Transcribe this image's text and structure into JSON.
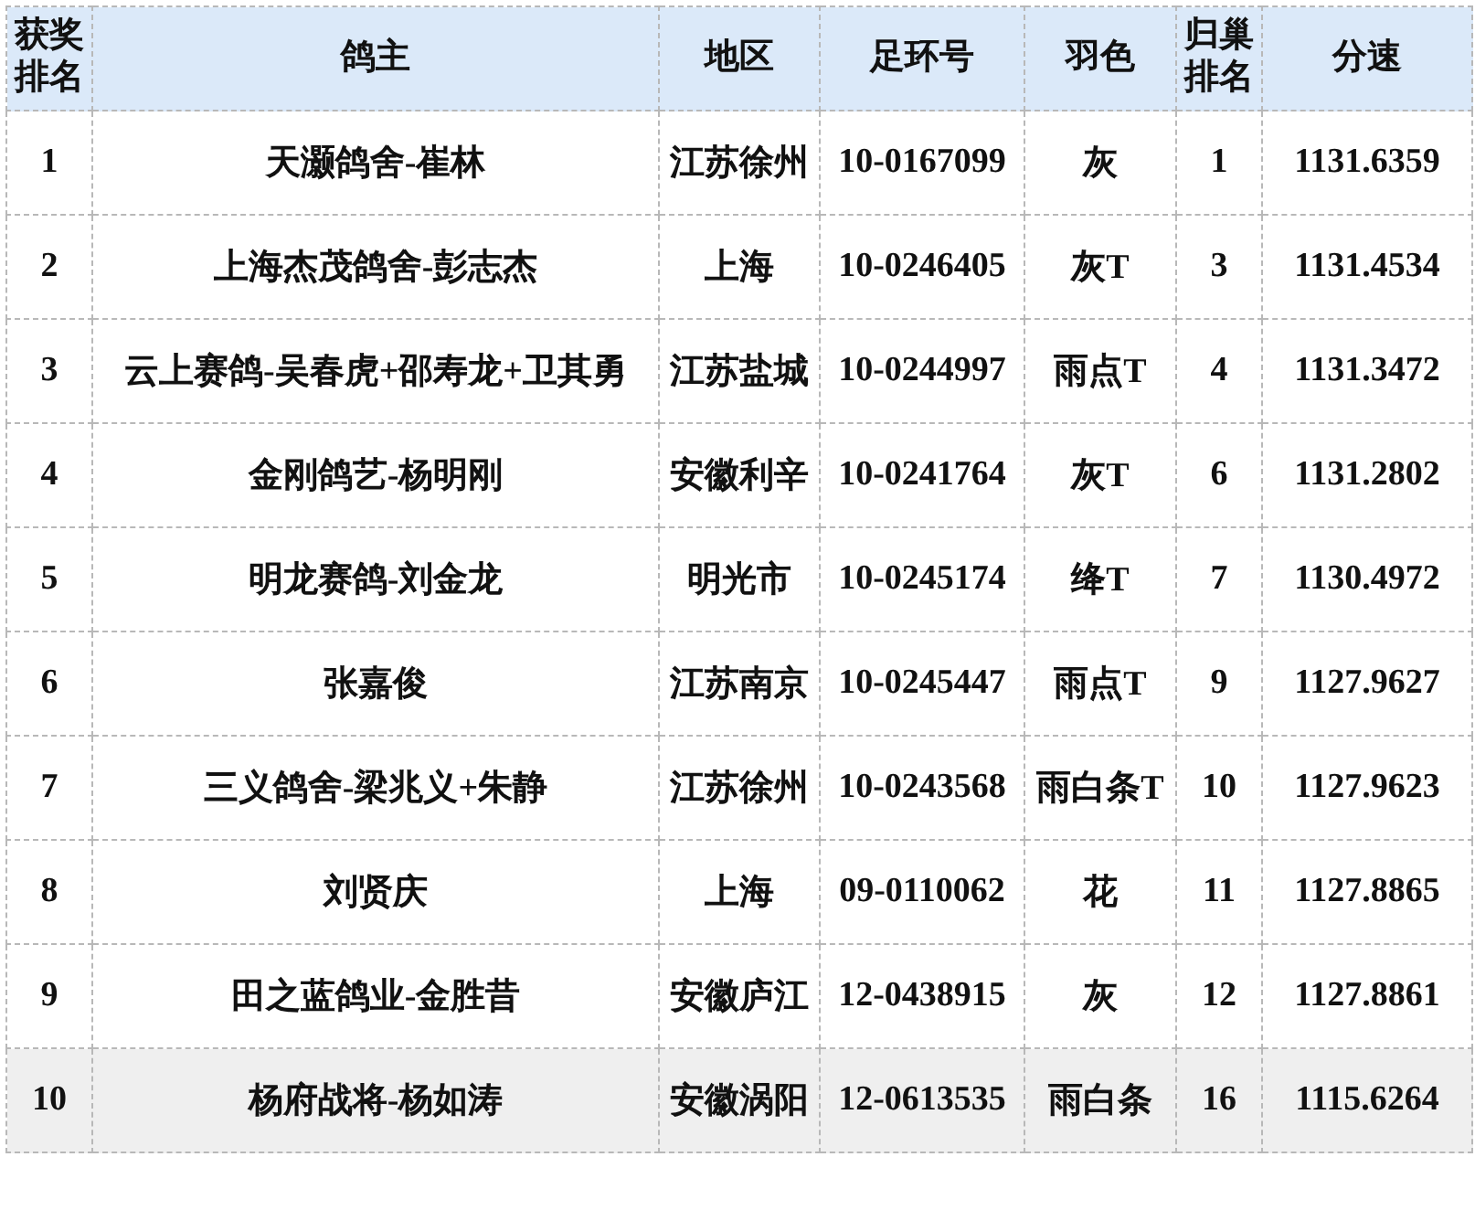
{
  "table": {
    "columns": [
      "获奖排名",
      "鸽主",
      "地区",
      "足环号",
      "羽色",
      "归巢排名",
      "分速"
    ],
    "rows": [
      {
        "cells": [
          "1",
          "天灏鸽舍-崔林",
          "江苏徐州",
          "10-0167099",
          "灰",
          "1",
          "1131.6359"
        ],
        "highlighted": false
      },
      {
        "cells": [
          "2",
          "上海杰茂鸽舍-彭志杰",
          "上海",
          "10-0246405",
          "灰T",
          "3",
          "1131.4534"
        ],
        "highlighted": false
      },
      {
        "cells": [
          "3",
          "云上赛鸽-吴春虎+邵寿龙+卫其勇",
          "江苏盐城",
          "10-0244997",
          "雨点T",
          "4",
          "1131.3472"
        ],
        "highlighted": false
      },
      {
        "cells": [
          "4",
          "金刚鸽艺-杨明刚",
          "安徽利辛",
          "10-0241764",
          "灰T",
          "6",
          "1131.2802"
        ],
        "highlighted": false
      },
      {
        "cells": [
          "5",
          "明龙赛鸽-刘金龙",
          "明光市",
          "10-0245174",
          "绛T",
          "7",
          "1130.4972"
        ],
        "highlighted": false
      },
      {
        "cells": [
          "6",
          "张嘉俊",
          "江苏南京",
          "10-0245447",
          "雨点T",
          "9",
          "1127.9627"
        ],
        "highlighted": false
      },
      {
        "cells": [
          "7",
          "三义鸽舍-梁兆义+朱静",
          "江苏徐州",
          "10-0243568",
          "雨白条T",
          "10",
          "1127.9623"
        ],
        "highlighted": false
      },
      {
        "cells": [
          "8",
          "刘贤庆",
          "上海",
          "09-0110062",
          "花",
          "11",
          "1127.8865"
        ],
        "highlighted": false
      },
      {
        "cells": [
          "9",
          "田之蓝鸽业-金胜昔",
          "安徽庐江",
          "12-0438915",
          "灰",
          "12",
          "1127.8861"
        ],
        "highlighted": false
      },
      {
        "cells": [
          "10",
          "杨府战将-杨如涛",
          "安徽涡阳",
          "12-0613535",
          "雨白条",
          "16",
          "1115.6264"
        ],
        "highlighted": true
      }
    ]
  }
}
